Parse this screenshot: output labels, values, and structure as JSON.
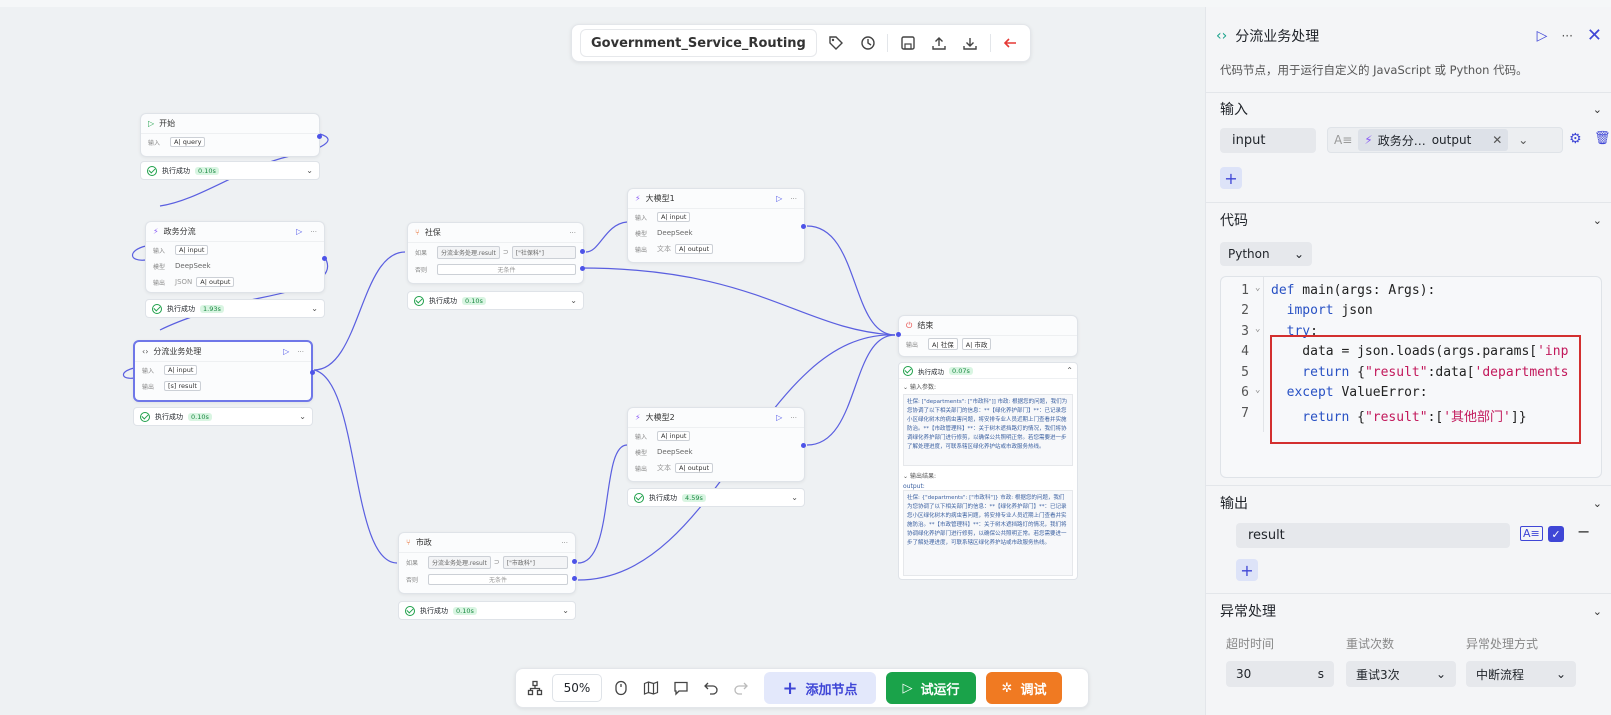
{
  "toolbar": {
    "workflow_name": "Government_Service_Routing",
    "icons": [
      "tag-icon",
      "history-icon",
      "save-icon",
      "upload-icon",
      "download-icon",
      "back-arrow-icon"
    ]
  },
  "nodes": {
    "start": {
      "title": "开始",
      "input_label": "输入",
      "input_value": "query",
      "status": "执行成功",
      "time": "0.10s"
    },
    "gov_split": {
      "title": "政务分流",
      "input_label": "输入",
      "input_value": "input",
      "model_label": "模型",
      "model_value": "DeepSeek",
      "output_label": "输出",
      "output_type": "JSON",
      "output_value": "output",
      "status": "执行成功",
      "time": "1.93s"
    },
    "biz_process": {
      "title": "分流业务处理",
      "input_label": "输入",
      "input_value": "input",
      "output_label": "输出",
      "output_value": "result",
      "status": "执行成功",
      "time": "0.10s"
    },
    "social": {
      "title": "社保",
      "if_label": "如果",
      "cond_left": "分流业务处理.result",
      "cond_right": "[\"社保科\"]",
      "else_label": "否则",
      "else_value": "无条件",
      "status": "执行成功",
      "time": "0.10s"
    },
    "municipal": {
      "title": "市政",
      "if_label": "如果",
      "cond_left": "分流业务处理.result",
      "cond_right": "[\"市政科\"]",
      "else_label": "否则",
      "else_value": "无条件",
      "status": "执行成功",
      "time": "0.10s"
    },
    "llm1": {
      "title": "大模型1",
      "input_label": "输入",
      "input_value": "input",
      "model_label": "模型",
      "model_value": "DeepSeek",
      "output_label": "输出",
      "output_type": "文本",
      "output_value": "output"
    },
    "llm2": {
      "title": "大模型2",
      "input_label": "输入",
      "input_value": "input",
      "model_label": "模型",
      "model_value": "DeepSeek",
      "output_label": "输出",
      "output_type": "文本",
      "output_value": "output",
      "status": "执行成功",
      "time": "4.59s"
    },
    "end": {
      "title": "结束",
      "output_label": "输出",
      "out1": "社保",
      "out2": "市政",
      "status": "执行成功",
      "time": "0.07s",
      "input_params_label": "输入参数:",
      "input_params_text": "社保:  [\"departments\": [\"市政科\"]]  市政: 根据您的问题，我们为您协调了以下相关部门的信息：**【绿化养护部门】**：已记录您小区绿化树木的病虫害问题，将安排专业人员近期上门查看并实施防治。**【市政管理科】**：关于树木遮挡路灯的情况，我们将协调绿化养护部门进行修剪，以确保公共照明正常。若您需要进一步了解处理进度，可联系辖区绿化养护站或市政服务热线。",
      "output_result_label": "输出结果:",
      "output_key": "output:",
      "output_text": "社保: {\"departments\": [\"市政科\"]}  市政: 根据您的问题，我们为您协调了以下相关部门的信息：**【绿化养护部门】**：已记录您小区绿化树木的病虫害问题，将安排专业人员近期上门查看并实施防治。**【市政管理科】**：关于树木遮挡路灯的情况，我们将协调绿化养护部门进行修剪，以确保公共照明正常。若您需要进一步了解处理进度，可联系辖区绿化养护站或市政服务热线。"
    }
  },
  "bottombar": {
    "zoom": "50%",
    "add_node": "添加节点",
    "test_run": "试运行",
    "debug": "调试"
  },
  "panel": {
    "title": "分流业务处理",
    "description": "代码节点，用于运行自定义的 JavaScript 或 Python 代码。",
    "input_section": "输入",
    "input_name": "input",
    "ref_source": "政务分…",
    "ref_field": "output",
    "code_section": "代码",
    "language": "Python",
    "code_lines": [
      {
        "num": "1",
        "fold": "⌄"
      },
      {
        "num": "2",
        "fold": ""
      },
      {
        "num": "3",
        "fold": "⌄"
      },
      {
        "num": "4",
        "fold": ""
      },
      {
        "num": "5",
        "fold": ""
      },
      {
        "num": "6",
        "fold": "⌄"
      },
      {
        "num": "7",
        "fold": ""
      }
    ],
    "code_text": {
      "l1a": "def",
      "l1b": " main(args: Args):",
      "l2a": "  import",
      "l2b": " json",
      "l3a": "  try",
      "l3b": ":",
      "l4a": "    data = json.loads(args.params[",
      "l4b": "'inp",
      "l5a": "    return",
      "l5b": " {",
      "l5c": "\"result\"",
      "l5d": ":data[",
      "l5e": "'departments",
      "l6a": "  except",
      "l6b": " ValueError:",
      "l7a": "    return",
      "l7b": " {",
      "l7c": "\"result\"",
      "l7d": ":[",
      "l7e": "'其他部门'",
      "l7f": "]}"
    },
    "output_section": "输出",
    "output_name": "result",
    "exception_section": "异常处理",
    "timeout_label": "超时时间",
    "retry_label": "重试次数",
    "handling_label": "异常处理方式",
    "timeout_value": "30",
    "timeout_unit": "s",
    "retry_value": "重试3次",
    "handling_value": "中断流程"
  }
}
